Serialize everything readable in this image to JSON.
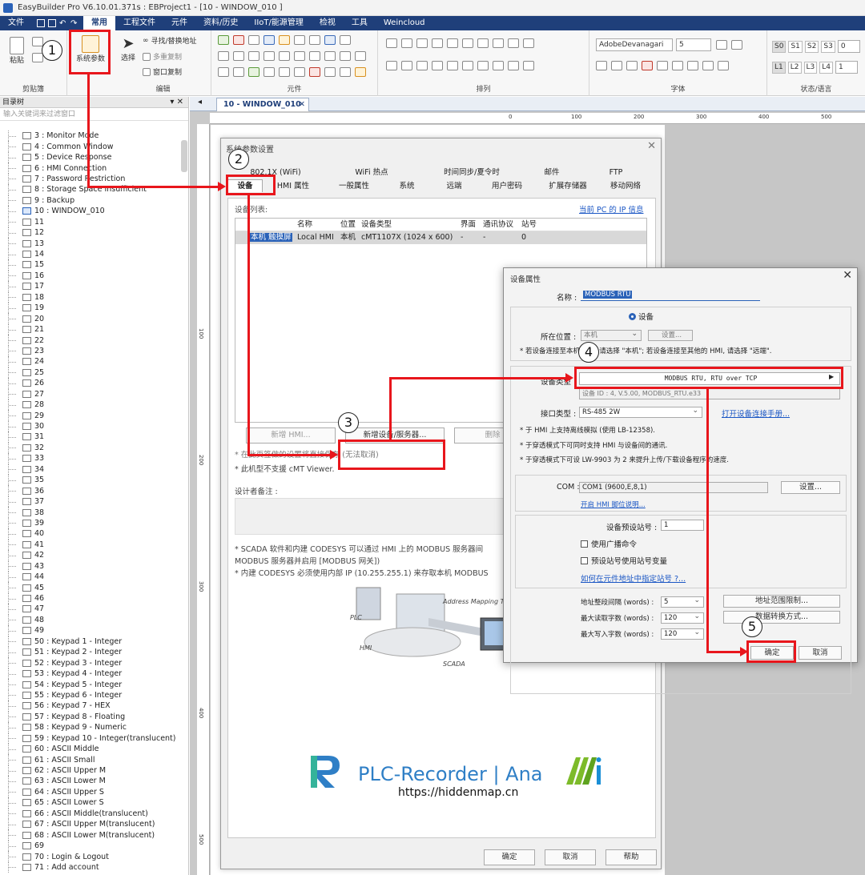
{
  "titlebar": {
    "text": "EasyBuilder Pro V6.10.01.371s : EBProject1 - [10 - WINDOW_010 ]"
  },
  "menubar": {
    "items": [
      {
        "label": "文件"
      },
      {
        "label": "常用",
        "active": true
      },
      {
        "label": "工程文件"
      },
      {
        "label": "元件"
      },
      {
        "label": "资料/历史"
      },
      {
        "label": "IIoT/能源管理"
      },
      {
        "label": "检视"
      },
      {
        "label": "工具"
      },
      {
        "label": "Weincloud"
      }
    ]
  },
  "ribbon": {
    "clipboard": {
      "paste": "粘贴",
      "group": "剪贴簿"
    },
    "sysparam": {
      "label": "系统参数"
    },
    "edit": {
      "select": "选择",
      "find_replace": "寻找/替换地址",
      "multi_copy": "多重复制",
      "window_copy": "窗口复制",
      "group": "编辑"
    },
    "elements": {
      "group": "元件"
    },
    "arrange": {
      "group": "排列"
    },
    "font": {
      "name": "AdobeDevanagari",
      "size": "5",
      "group": "字体"
    },
    "state": {
      "s_buttons": [
        "S0",
        "S1",
        "S2",
        "S3"
      ],
      "s_value": "0",
      "l_buttons": [
        "L1",
        "L2",
        "L3",
        "L4"
      ],
      "l_value": "1",
      "group": "状态/语言"
    }
  },
  "leftpanel": {
    "title": "目录树",
    "filter_placeholder": "输入关键词来过滤窗口",
    "items": [
      "3 : Monitor Mode",
      "4 : Common Window",
      "5 : Device Response",
      "6 : HMI Connection",
      "7 : Password Restriction",
      "8 : Storage Space Insufficient",
      "9 : Backup",
      "10 : WINDOW_010",
      "11",
      "12",
      "13",
      "14",
      "15",
      "16",
      "17",
      "18",
      "19",
      "20",
      "21",
      "22",
      "23",
      "24",
      "25",
      "26",
      "27",
      "28",
      "29",
      "30",
      "31",
      "32",
      "33",
      "34",
      "35",
      "36",
      "37",
      "38",
      "39",
      "40",
      "41",
      "42",
      "43",
      "44",
      "45",
      "46",
      "47",
      "48",
      "49",
      "50 : Keypad 1 - Integer",
      "51 : Keypad 2 - Integer",
      "52 : Keypad 3 - Integer",
      "53 : Keypad 4 - Integer",
      "54 : Keypad 5 - Integer",
      "55 : Keypad 6 - Integer",
      "56 : Keypad 7 - HEX",
      "57 : Keypad 8 - Floating",
      "58 : Keypad 9 - Numeric",
      "59 : Keypad 10 - Integer(translucent)",
      "60 : ASCII Middle",
      "61 : ASCII Small",
      "62 : ASCII Upper M",
      "63 : ASCII Lower M",
      "64 : ASCII Upper S",
      "65 : ASCII Lower S",
      "66 : ASCII Middle(translucent)",
      "67 : ASCII Upper M(translucent)",
      "68 : ASCII Lower M(translucent)",
      "69",
      "70 : Login & Logout",
      "71 : Add account"
    ]
  },
  "doctab": {
    "label": "10 - WINDOW_010"
  },
  "ruler": {
    "marks": [
      "0",
      "100",
      "200",
      "300",
      "400",
      "500"
    ],
    "left_marks": [
      "100",
      "200",
      "300",
      "400",
      "500"
    ]
  },
  "dlg1": {
    "title": "系统参数设置",
    "tabs_row1": [
      "802.1X (WiFi)",
      "WiFi 热点",
      "时间同步/夏令时",
      "邮件",
      "FTP"
    ],
    "tabs_row2": [
      "设备",
      "HMI 属性",
      "一般属性",
      "系统",
      "远端",
      "用户密码",
      "扩展存储器",
      "移动网络"
    ],
    "devlist_label": "设备列表:",
    "ip_link": "当前 PC 的 IP 信息",
    "table": {
      "headers": [
        "",
        "名称",
        "位置",
        "设备类型",
        "界面",
        "通讯协议",
        "站号"
      ],
      "row": [
        "本机 触摸屏",
        "Local HMI",
        "本机",
        "cMT1107X (1024 x 600)",
        "-",
        "-",
        "0"
      ]
    },
    "btn_new_hmi": "新增 HMI...",
    "btn_new_device": "新增设备/服务器...",
    "btn_delete": "删除",
    "note1": "* 在此页签做的设置将直接保存 (无法取消)",
    "note2": "* 此机型不支援 cMT Viewer.",
    "designer_note": "设计者备注 :",
    "scada1": "* SCADA 软件和内建 CODESYS 可以通过 HMI 上的 MODBUS 服务器间",
    "scada2": "MODBUS 服务器并启用 [MODBUS 网关])",
    "scada3": "* 内建 CODESYS 必须使用内部 IP (10.255.255.1) 来存取本机 MODBUS",
    "diagram": {
      "address_mapping": "Address Mapping Table",
      "plc": "PLC",
      "hmi": "HMI",
      "scada": "SCADA"
    },
    "ok": "确定",
    "cancel": "取消",
    "help": "帮助"
  },
  "dlg2": {
    "title": "设备属性",
    "name_label": "名称 :",
    "name_value": "MODBUS RTU",
    "radio_label": "设备",
    "location_label": "所在位置 :",
    "location_value": "本机",
    "location_settings": "设置...",
    "location_hint": "* 若设备连接至本机 HMI, 请选择 \"本机\"; 若设备连接至其他的 HMI, 请选择 \"远端\".",
    "devtype_label": "设备类型 :",
    "devtype_value": "MODBUS RTU, RTU over TCP",
    "devid": "设备 ID : 4, V.5.00, MODBUS_RTU.e33",
    "iface_label": "接口类型 :",
    "iface_value": "RS-485 2W",
    "manual_link": "打开设备连接手册...",
    "hint1": "* 于 HMI 上支持离线模拟 (使用 LB-12358).",
    "hint2": "* 于穿透模式下可同时支持 HMI 与设备间的通讯.",
    "hint3": "* 于穿透模式下可设 LW-9903 为 2 来提升上传/下载设备程序的速度.",
    "com_label": "COM :",
    "com_value": "COM1 (9600,E,8,1)",
    "com_settings": "设置...",
    "pin_link": "开启 HMI 脚位说明...",
    "default_station_label": "设备预设站号 :",
    "default_station_value": "1",
    "chk_broadcast": "使用广播命令",
    "chk_station_var": "预设站号使用站号变量",
    "station_link": "如何在元件地址中指定站号 ?...",
    "addr_gap_label": "地址整段间隔 (words) :",
    "addr_gap_value": "5",
    "max_read_label": "最大读取字数 (words) :",
    "max_read_value": "120",
    "max_write_label": "最大写入字数 (words) :",
    "max_write_value": "120",
    "addr_limit_btn": "地址范围限制...",
    "data_conv_btn": "数据转换方式...",
    "ok": "确定",
    "cancel": "取消"
  },
  "annotations": {
    "steps": [
      "1",
      "2",
      "3",
      "4",
      "5"
    ],
    "color": "#e8161c"
  },
  "watermark": {
    "brand": "PLC-Recorder | Ana",
    "url": "https://hiddenmap.cn",
    "brand_color": "#2f7fc6",
    "ai_color": "#7dbb2a"
  }
}
